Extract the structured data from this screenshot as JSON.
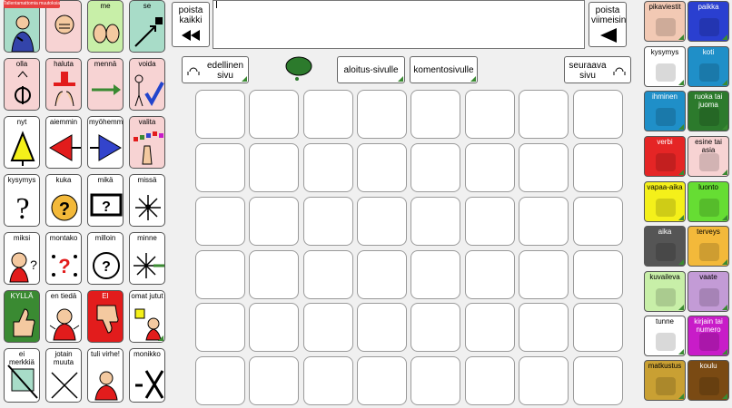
{
  "badge": "Tallentamattomia muutoksia",
  "left_grid": [
    [
      "",
      "",
      "me",
      "se"
    ],
    [
      "olla",
      "haluta",
      "mennä",
      "voida"
    ],
    [
      "nyt",
      "aiemmin",
      "myöhemmin",
      "valita"
    ],
    [
      "kysymys",
      "kuka",
      "mikä",
      "missä"
    ],
    [
      "miksi",
      "montako",
      "milloin",
      "minne"
    ],
    [
      "KYLLÄ",
      "en tiedä",
      "EI",
      "omat jutut"
    ],
    [
      "ei merkkiä",
      "jotain muuta",
      "tuli virhe!",
      "monikko"
    ]
  ],
  "toolbar": {
    "delete": "poista kaikki",
    "delete_last": "poista viimeisin",
    "message_text": "",
    "prev_page": "edellinen sivu",
    "start_page": "aloitus-sivulle",
    "command_page": "komentosivulle",
    "next_page": "seuraava sivu"
  },
  "right_grid": [
    [
      "pikaviestit",
      "paikka"
    ],
    [
      "kysymys",
      "koti"
    ],
    [
      "ihminen",
      "ruoka tai juoma"
    ],
    [
      "verbi",
      "esine tai asia"
    ],
    [
      "vapaa-aika",
      "luonto"
    ],
    [
      "aika",
      "terveys"
    ],
    [
      "kuvaileva",
      "vaate"
    ],
    [
      "tunne",
      "kirjain tai numero"
    ],
    [
      "matkustus",
      "koulu"
    ]
  ],
  "colors": {
    "pink": "#f7d3d3",
    "yes_green": "#3a8a32",
    "no_red": "#e21c1c",
    "blue": "#3344cc",
    "right": [
      [
        "#f2c9b4",
        "#2a3fd0"
      ],
      [
        "#ffffff",
        "#1f8fc8"
      ],
      [
        "#1f8fc8",
        "#2c7a2c"
      ],
      [
        "#e52525",
        "#f7d3d3"
      ],
      [
        "#f4f01a",
        "#66dd33"
      ],
      [
        "#555555",
        "#f3b93a"
      ],
      [
        "#c8efa8",
        "#c39bd6"
      ],
      [
        "#ffffff",
        "#c81cc8"
      ],
      [
        "#c9a033",
        "#7a4a13"
      ]
    ]
  }
}
